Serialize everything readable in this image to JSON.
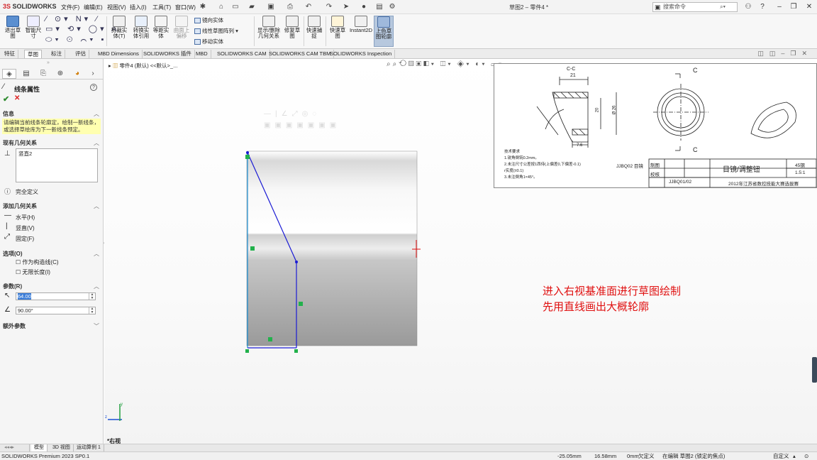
{
  "app": {
    "logo_prefix": "3S",
    "logo_name": "SOLIDWORKS"
  },
  "menu": [
    "文件(F)",
    "编辑(E)",
    "视图(V)",
    "插入(I)",
    "工具(T)",
    "窗口(W)"
  ],
  "doc_title": "草图2 – 零件4 *",
  "search": {
    "placeholder": "搜索命令"
  },
  "ribbon": {
    "exit_sketch": "退出草\n图",
    "smart_dim": "智能尺\n寸",
    "trim": "剪裁实\n体(T)",
    "convert": "转换实\n体引用",
    "offset": "等距实\n体",
    "surface": "曲面上\n偏移",
    "mirror": "镜向实体",
    "linear_pattern": "线性草图阵列",
    "move": "移动实体",
    "display_delete": "显示/删除\n几何关系",
    "repair": "修复草\n图",
    "snap": "快速捕\n捉",
    "rapid_sketch": "快速草\n图",
    "instant2d": "Instant2D",
    "shaded": "上色草\n图轮廓"
  },
  "command_tabs": [
    "特征",
    "草图",
    "标注",
    "评估",
    "MBD Dimensions",
    "SOLIDWORKS 插件",
    "MBD",
    "SOLIDWORKS CAM",
    "SOLIDWORKS CAM TBM",
    "SOLIDWORKS Inspection"
  ],
  "property_manager": {
    "title": "线条属性",
    "message_header": "信息",
    "message": "请编辑当前线条轮廓定，绘制一新线条，或选择草绘库为下一新线条预定。",
    "existing_relations": "现有几何关系",
    "relation_item": "竖直2",
    "fully_defined": "完全定义",
    "add_relations": "添加几何关系",
    "horizontal": "水平(H)",
    "vertical": "竖直(V)",
    "fix": "固定(F)",
    "options": "选项(O)",
    "construction": "作为构造线(C)",
    "infinite": "无限长度(I)",
    "params": "参数(R)",
    "length": "64.00",
    "angle": "90.00°",
    "extra_params": "额外参数"
  },
  "tree_label": "零件4 (默认) <<默认>_...",
  "drawing": {
    "section": "C-C",
    "dim_21": "21",
    "dim_7_6": "7.6",
    "dim_20": "20",
    "dim_26": "Ø 26",
    "cut_c": "C",
    "notes_title": "技术要求",
    "notes": [
      "1.锐角倒钝0.2mm。",
      "2.未注尺寸公差按1西侍(上偏差0,下偏差-0.1)",
      "r实度(±0.1)",
      "3.未注倒角1×45°。"
    ],
    "code_left": "JJBQ02 目镜",
    "tb_draw": "制图",
    "tb_check": "校核",
    "tb_name": "目镜/调整钮",
    "tb_material": "45钢",
    "tb_scale": "1.5:1",
    "tb_code": "JJBQ01/02",
    "tb_event": "2012年江苏省数控技能大赛选拔赛"
  },
  "annotation": {
    "line1": "进入右视基准面进行草图绘制",
    "line2": "先用直线画出大概轮廓"
  },
  "view_name": "*右视",
  "bottom_tabs": [
    "模型",
    "3D 视图",
    "运动算例 1"
  ],
  "status": {
    "product": "SOLIDWORKS Premium 2023 SP0.1",
    "x": "-25.05mm",
    "y": "16.58mm",
    "z": "0mm",
    "defined": "欠定义",
    "editing": "在编辑 草图2 (锁定的焦点)",
    "custom": "自定义"
  },
  "colors": {
    "sketch_line": "#1a1ad4",
    "accent_red": "#e01010",
    "relation_green": "#22b14c"
  }
}
